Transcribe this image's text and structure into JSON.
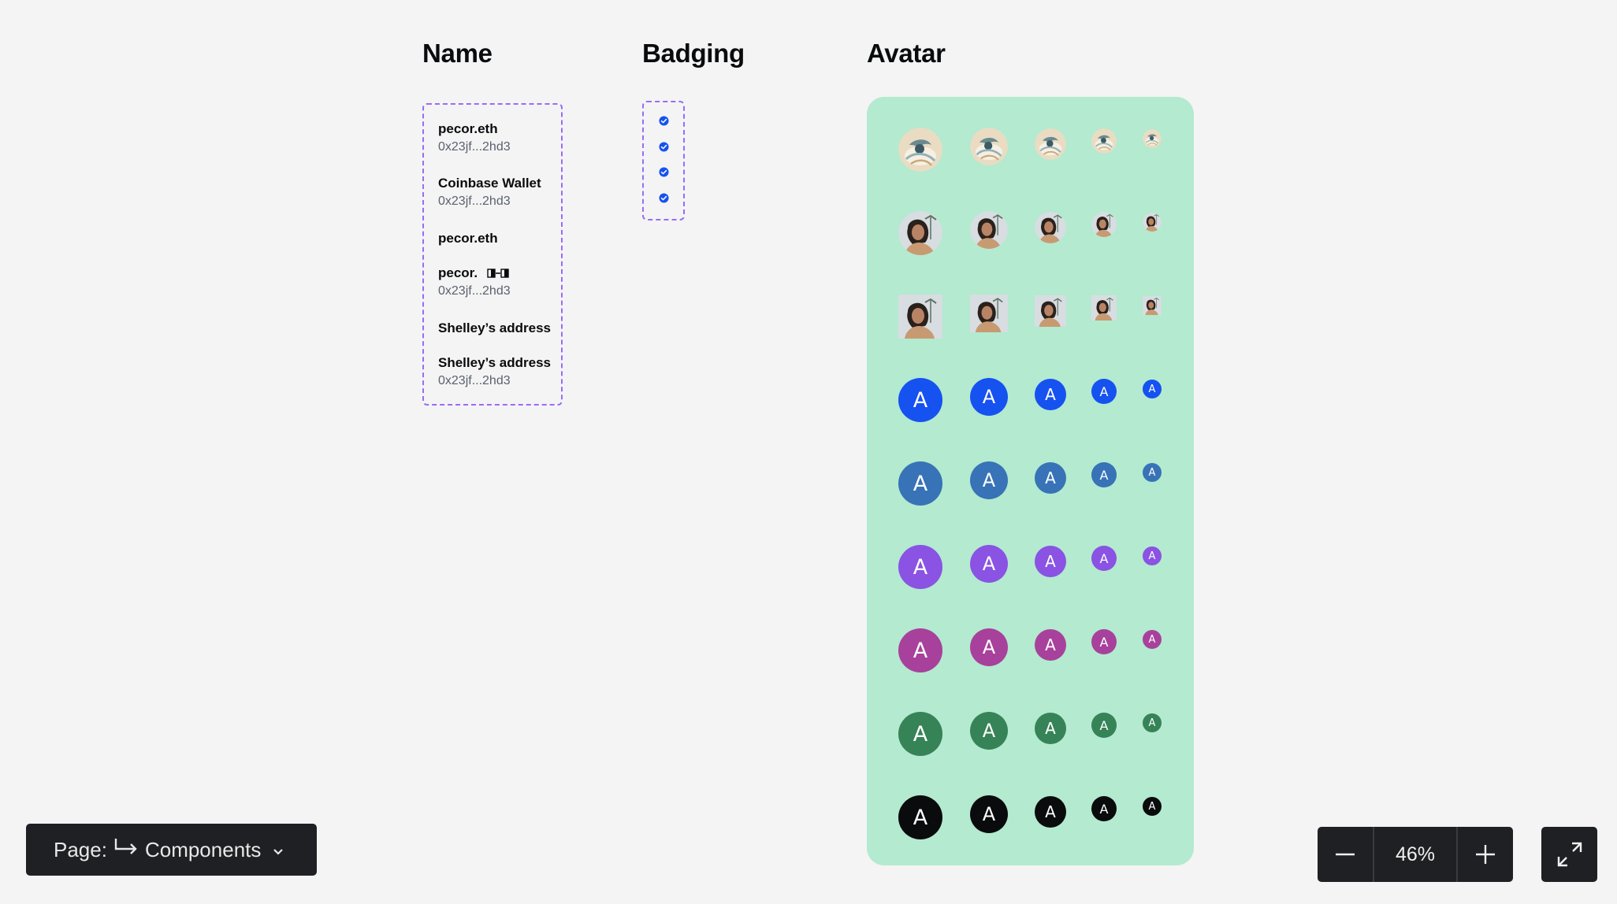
{
  "sections": {
    "name_title": "Name",
    "badging_title": "Badging",
    "avatar_title": "Avatar"
  },
  "names": [
    {
      "primary": "pecor.eth",
      "secondary": "0x23jf...2hd3"
    },
    {
      "primary": "Coinbase Wallet",
      "secondary": "0x23jf...2hd3"
    },
    {
      "primary": "pecor.eth",
      "secondary": ""
    },
    {
      "primary": "pecor.",
      "secondary": "0x23jf...2hd3",
      "icon": "badge-placeholder-icon"
    },
    {
      "primary": "Shelley’s address",
      "secondary": ""
    },
    {
      "primary": "Shelley’s address",
      "secondary": "0x23jf...2hd3"
    }
  ],
  "badges": [
    {
      "icon": "verified-check-icon"
    },
    {
      "icon": "verified-check-icon"
    },
    {
      "icon": "verified-check-icon"
    },
    {
      "icon": "verified-check-icon"
    }
  ],
  "avatar_rows": [
    {
      "kind": "illustration",
      "letter": ""
    },
    {
      "kind": "photo-circle",
      "letter": ""
    },
    {
      "kind": "photo-square",
      "letter": ""
    },
    {
      "kind": "letter",
      "letter": "A",
      "color": "#1652f0"
    },
    {
      "kind": "letter",
      "letter": "A",
      "color": "#3773b6"
    },
    {
      "kind": "letter",
      "letter": "A",
      "color": "#8a53e3"
    },
    {
      "kind": "letter",
      "letter": "A",
      "color": "#a8419b"
    },
    {
      "kind": "letter",
      "letter": "A",
      "color": "#368357"
    },
    {
      "kind": "letter",
      "letter": "A",
      "color": "#0a0b0d"
    }
  ],
  "colors": {
    "avatar_panel": "#b3ead0",
    "frame_border": "#9a6cf6",
    "badge_blue": "#1652f0",
    "toolbar_bg": "#1f2023"
  },
  "toolbar": {
    "page_label": "Page:",
    "page_name": "Components",
    "zoom_level": "46%"
  }
}
